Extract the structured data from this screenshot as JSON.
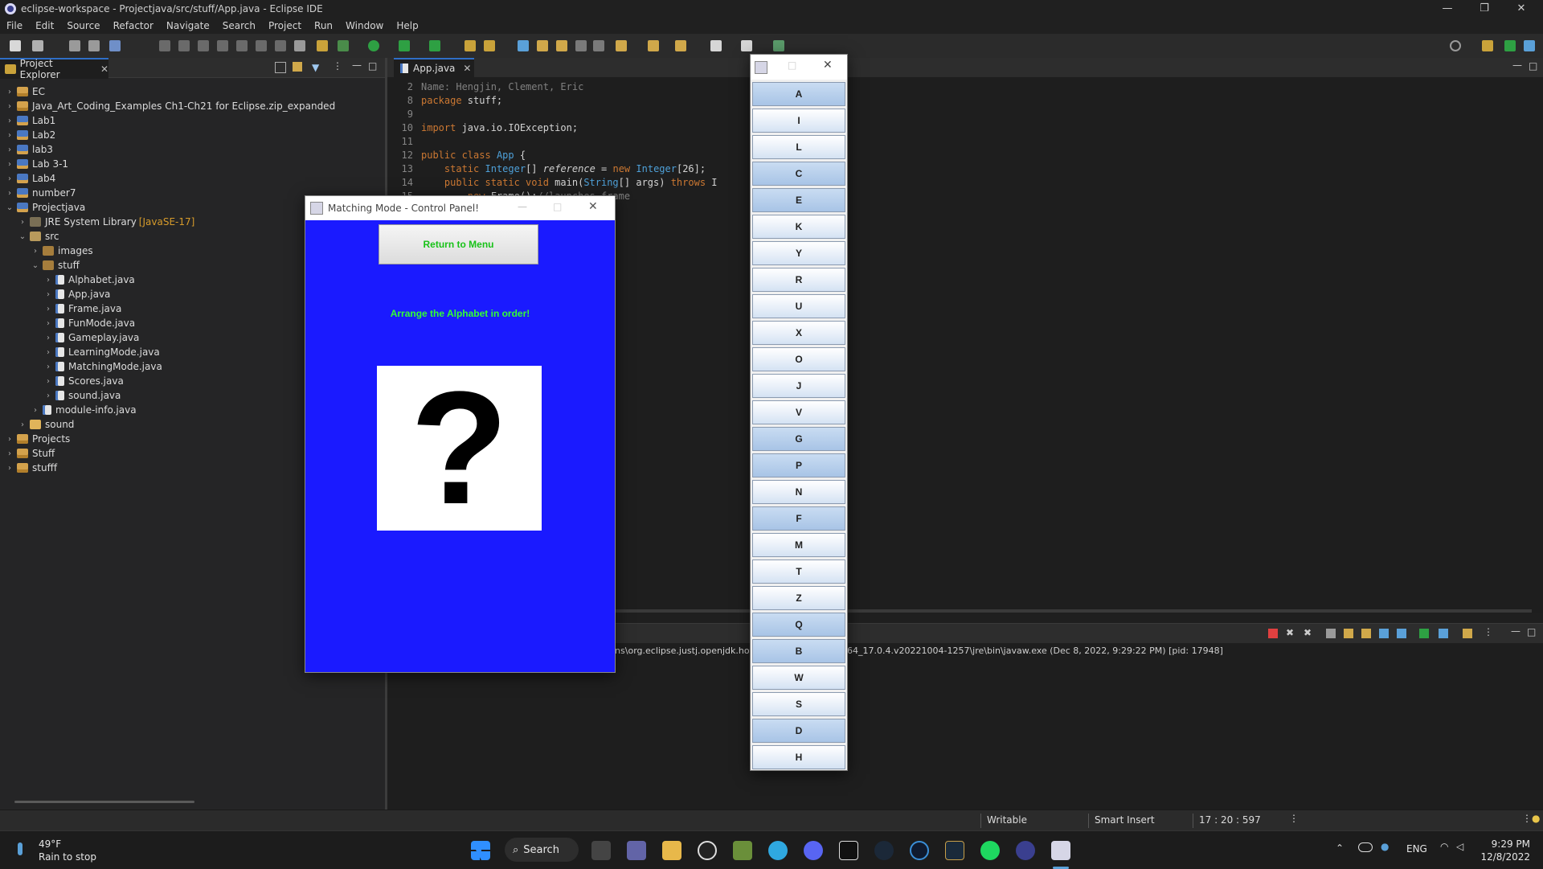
{
  "window": {
    "title": "eclipse-workspace - Projectjava/src/stuff/App.java - Eclipse IDE"
  },
  "menu": [
    "File",
    "Edit",
    "Source",
    "Refactor",
    "Navigate",
    "Search",
    "Project",
    "Run",
    "Window",
    "Help"
  ],
  "explorer": {
    "tab_label": "Project Explorer",
    "tree": [
      {
        "label": "EC",
        "depth": 0,
        "icon": "project",
        "arrow": "›",
        "tag": ""
      },
      {
        "label": "Java_Art_Coding_Examples Ch1-Ch21 for Eclipse.zip_expanded",
        "depth": 0,
        "icon": "project",
        "arrow": "›",
        "tag": ""
      },
      {
        "label": "Lab1",
        "depth": 0,
        "icon": "java-project",
        "arrow": "›",
        "tag": ""
      },
      {
        "label": "Lab2",
        "depth": 0,
        "icon": "java-project",
        "arrow": "›",
        "tag": ""
      },
      {
        "label": "lab3",
        "depth": 0,
        "icon": "java-project",
        "arrow": "›",
        "tag": ""
      },
      {
        "label": "Lab 3-1",
        "depth": 0,
        "icon": "java-project",
        "arrow": "›",
        "tag": ""
      },
      {
        "label": "Lab4",
        "depth": 0,
        "icon": "java-project",
        "arrow": "›",
        "tag": ""
      },
      {
        "label": "number7",
        "depth": 0,
        "icon": "java-project",
        "arrow": "›",
        "tag": ""
      },
      {
        "label": "Projectjava",
        "depth": 0,
        "icon": "java-project",
        "arrow": "⌄",
        "tag": ""
      },
      {
        "label": "JRE System Library",
        "depth": 1,
        "icon": "library",
        "arrow": "›",
        "tag": "[JavaSE-17]"
      },
      {
        "label": "src",
        "depth": 1,
        "icon": "source-folder",
        "arrow": "⌄",
        "tag": ""
      },
      {
        "label": "images",
        "depth": 2,
        "icon": "package",
        "arrow": "›",
        "tag": ""
      },
      {
        "label": "stuff",
        "depth": 2,
        "icon": "package",
        "arrow": "⌄",
        "tag": ""
      },
      {
        "label": "Alphabet.java",
        "depth": 3,
        "icon": "java",
        "arrow": "›",
        "tag": ""
      },
      {
        "label": "App.java",
        "depth": 3,
        "icon": "java",
        "arrow": "›",
        "tag": ""
      },
      {
        "label": "Frame.java",
        "depth": 3,
        "icon": "java",
        "arrow": "›",
        "tag": ""
      },
      {
        "label": "FunMode.java",
        "depth": 3,
        "icon": "java",
        "arrow": "›",
        "tag": ""
      },
      {
        "label": "Gameplay.java",
        "depth": 3,
        "icon": "java",
        "arrow": "›",
        "tag": ""
      },
      {
        "label": "LearningMode.java",
        "depth": 3,
        "icon": "java",
        "arrow": "›",
        "tag": ""
      },
      {
        "label": "MatchingMode.java",
        "depth": 3,
        "icon": "java",
        "arrow": "›",
        "tag": ""
      },
      {
        "label": "Scores.java",
        "depth": 3,
        "icon": "java",
        "arrow": "›",
        "tag": ""
      },
      {
        "label": "sound.java",
        "depth": 3,
        "icon": "java",
        "arrow": "›",
        "tag": ""
      },
      {
        "label": "module-info.java",
        "depth": 2,
        "icon": "java",
        "arrow": "›",
        "tag": ""
      },
      {
        "label": "sound",
        "depth": 1,
        "icon": "folder",
        "arrow": "›",
        "tag": ""
      },
      {
        "label": "Projects",
        "depth": 0,
        "icon": "project",
        "arrow": "›",
        "tag": ""
      },
      {
        "label": "Stuff",
        "depth": 0,
        "icon": "project",
        "arrow": "›",
        "tag": ""
      },
      {
        "label": "stufff",
        "depth": 0,
        "icon": "project",
        "arrow": "›",
        "tag": ""
      }
    ]
  },
  "editor": {
    "tab_label": "App.java",
    "lines": [
      {
        "n": "2",
        "tokens": [
          [
            "cm",
            "Name: Hengjin, Clement, Eric"
          ]
        ]
      },
      {
        "n": "8",
        "tokens": [
          [
            "kw",
            "package"
          ],
          [
            "pl",
            " stuff;"
          ]
        ]
      },
      {
        "n": "9",
        "tokens": []
      },
      {
        "n": "10",
        "tokens": [
          [
            "kw",
            "import"
          ],
          [
            "pl",
            " java.io.IOException;"
          ]
        ]
      },
      {
        "n": "11",
        "tokens": []
      },
      {
        "n": "12",
        "tokens": [
          [
            "kw",
            "public class"
          ],
          [
            "pl",
            " "
          ],
          [
            "ty",
            "App"
          ],
          [
            "pl",
            " {"
          ]
        ]
      },
      {
        "n": "13",
        "tokens": [
          [
            "pl",
            "    "
          ],
          [
            "kw",
            "static"
          ],
          [
            "pl",
            " "
          ],
          [
            "ty",
            "Integer"
          ],
          [
            "pl",
            "[] "
          ],
          [
            "fd",
            "reference"
          ],
          [
            "pl",
            " = "
          ],
          [
            "kw",
            "new"
          ],
          [
            "pl",
            " "
          ],
          [
            "ty",
            "Integer"
          ],
          [
            "pl",
            "[26];"
          ]
        ]
      },
      {
        "n": "14",
        "tokens": [
          [
            "pl",
            "    "
          ],
          [
            "kw",
            "public static void"
          ],
          [
            "pl",
            " main("
          ],
          [
            "ty",
            "String"
          ],
          [
            "pl",
            "[] args) "
          ],
          [
            "kw",
            "throws"
          ],
          [
            "pl",
            " I"
          ]
        ]
      },
      {
        "n": "15",
        "tokens": [
          [
            "pl",
            "        "
          ],
          [
            "kw",
            "new"
          ],
          [
            "pl",
            " Frame();"
          ],
          [
            "cm",
            "//launches frame"
          ]
        ]
      }
    ]
  },
  "console": {
    "path_left": "ins\\org.eclipse.justj.openjdk.hot",
    "path_right": "64_17.0.4.v20221004-1257\\jre\\bin\\javaw.exe  (Dec 8, 2022, 9:29:22 PM) [pid: 17948]"
  },
  "status": {
    "writable": "Writable",
    "insert_mode": "Smart Insert",
    "position": "17 : 20 : 597"
  },
  "matching_window": {
    "title": "Matching Mode - Control Panel!",
    "return_button": "Return to Menu",
    "instruction": "Arrange the Alphabet in order!",
    "image_text": "?",
    "background_color": "#1a1aff"
  },
  "letter_window": {
    "letters": [
      {
        "label": "A",
        "style": "blue"
      },
      {
        "label": "I",
        "style": "white"
      },
      {
        "label": "L",
        "style": "white"
      },
      {
        "label": "C",
        "style": "blue"
      },
      {
        "label": "E",
        "style": "blue"
      },
      {
        "label": "K",
        "style": "white"
      },
      {
        "label": "Y",
        "style": "white"
      },
      {
        "label": "R",
        "style": "white"
      },
      {
        "label": "U",
        "style": "white"
      },
      {
        "label": "X",
        "style": "white"
      },
      {
        "label": "O",
        "style": "white"
      },
      {
        "label": "J",
        "style": "white"
      },
      {
        "label": "V",
        "style": "white"
      },
      {
        "label": "G",
        "style": "blue"
      },
      {
        "label": "P",
        "style": "blue"
      },
      {
        "label": "N",
        "style": "white"
      },
      {
        "label": "F",
        "style": "blue"
      },
      {
        "label": "M",
        "style": "white"
      },
      {
        "label": "T",
        "style": "white"
      },
      {
        "label": "Z",
        "style": "white"
      },
      {
        "label": "Q",
        "style": "blue"
      },
      {
        "label": "B",
        "style": "blue"
      },
      {
        "label": "W",
        "style": "white"
      },
      {
        "label": "S",
        "style": "white"
      },
      {
        "label": "D",
        "style": "blue"
      },
      {
        "label": "H",
        "style": "white"
      }
    ]
  },
  "taskbar": {
    "weather_temp": "49°F",
    "weather_desc": "Rain to stop",
    "search_label": "Search",
    "language": "ENG",
    "time": "9:29 PM",
    "date": "12/8/2022"
  }
}
